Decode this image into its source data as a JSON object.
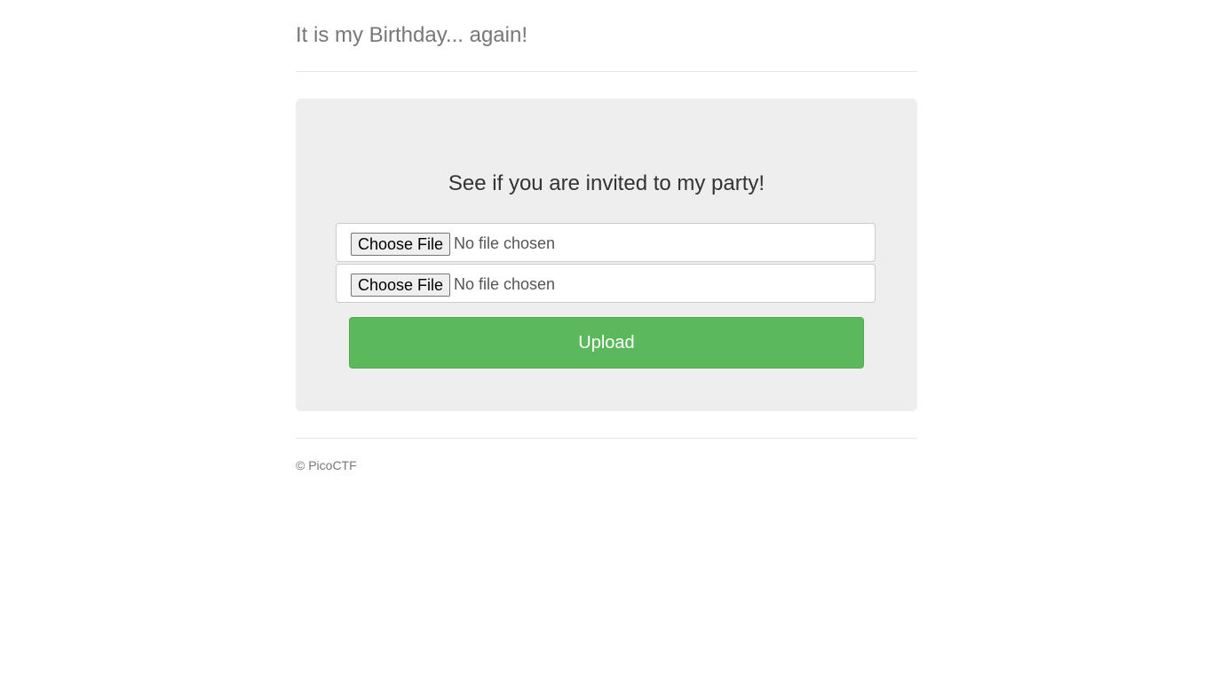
{
  "header": {
    "title": "It is my Birthday... again!"
  },
  "main": {
    "lead": "See if you are invited to my party!",
    "file_inputs": [
      {
        "button_label": "Choose File",
        "status": "No file chosen"
      },
      {
        "button_label": "Choose File",
        "status": "No file chosen"
      }
    ],
    "upload_label": "Upload"
  },
  "footer": {
    "text": "© PicoCTF"
  },
  "colors": {
    "upload_button": "#5cb85c",
    "jumbotron_bg": "#eeeeee"
  }
}
